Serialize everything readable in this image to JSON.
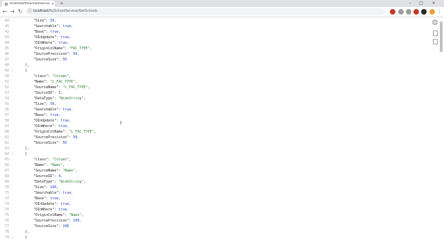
{
  "browser": {
    "tab_title": "localhost/fis/SchoolService/Get",
    "tab_close": "×",
    "new_tab": "+",
    "url_host": "localhost",
    "url_path": "/fis/SchoolService/GetSchools",
    "window_controls": [
      "–",
      "□",
      "×"
    ],
    "extension_colors": [
      "#c0392b",
      "#9e9e9e",
      "#9e9e9e",
      "#c0392b",
      "#2a2a2a",
      "#e8a33d"
    ]
  },
  "code_lines": [
    {
      "n": "40",
      "fold": "",
      "indent": "        ",
      "parts": [
        {
          "t": "\"Size\"",
          "c": "k"
        },
        {
          "t": ": ",
          "c": "p"
        },
        {
          "t": "50",
          "c": "n"
        },
        {
          "t": ",",
          "c": "p"
        }
      ]
    },
    {
      "n": "41",
      "fold": "",
      "indent": "        ",
      "parts": [
        {
          "t": "\"Searchable\"",
          "c": "k"
        },
        {
          "t": ": ",
          "c": "p"
        },
        {
          "t": "true",
          "c": "n"
        },
        {
          "t": ",",
          "c": "p"
        }
      ]
    },
    {
      "n": "42",
      "fold": "",
      "indent": "        ",
      "parts": [
        {
          "t": "\"Base\"",
          "c": "k"
        },
        {
          "t": ": ",
          "c": "p"
        },
        {
          "t": "true",
          "c": "n"
        },
        {
          "t": ",",
          "c": "p"
        }
      ]
    },
    {
      "n": "43",
      "fold": "",
      "indent": "        ",
      "parts": [
        {
          "t": "\"OInUpdate\"",
          "c": "k"
        },
        {
          "t": ": ",
          "c": "p"
        },
        {
          "t": "true",
          "c": "n"
        },
        {
          "t": ",",
          "c": "p"
        }
      ]
    },
    {
      "n": "44",
      "fold": "",
      "indent": "        ",
      "parts": [
        {
          "t": "\"OInWhere\"",
          "c": "k"
        },
        {
          "t": ": ",
          "c": "p"
        },
        {
          "t": "true",
          "c": "n"
        },
        {
          "t": ",",
          "c": "p"
        }
      ]
    },
    {
      "n": "45",
      "fold": "",
      "indent": "        ",
      "parts": [
        {
          "t": "\"OriginColName\"",
          "c": "k"
        },
        {
          "t": ": ",
          "c": "p"
        },
        {
          "t": "\"FAC_TYPE\"",
          "c": "s"
        },
        {
          "t": ",",
          "c": "p"
        }
      ]
    },
    {
      "n": "46",
      "fold": "",
      "indent": "        ",
      "parts": [
        {
          "t": "\"SourcePrecision\"",
          "c": "k"
        },
        {
          "t": ": ",
          "c": "p"
        },
        {
          "t": "50",
          "c": "n"
        },
        {
          "t": ",",
          "c": "p"
        }
      ]
    },
    {
      "n": "47",
      "fold": "",
      "indent": "        ",
      "parts": [
        {
          "t": "\"SourceSize\"",
          "c": "k"
        },
        {
          "t": ": ",
          "c": "p"
        },
        {
          "t": "50",
          "c": "n"
        }
      ]
    },
    {
      "n": "48",
      "fold": "",
      "indent": "    ",
      "parts": [
        {
          "t": "},",
          "c": "p"
        }
      ]
    },
    {
      "n": "49",
      "fold": "▾",
      "indent": "    ",
      "parts": [
        {
          "t": "{",
          "c": "p"
        }
      ]
    },
    {
      "n": "50",
      "fold": "",
      "indent": "        ",
      "parts": [
        {
          "t": "\"class\"",
          "c": "k"
        },
        {
          "t": ": ",
          "c": "p"
        },
        {
          "t": "\"Column\"",
          "c": "s"
        },
        {
          "t": ",",
          "c": "p"
        }
      ]
    },
    {
      "n": "51",
      "fold": "",
      "indent": "        ",
      "parts": [
        {
          "t": "\"Name\"",
          "c": "k"
        },
        {
          "t": ": ",
          "c": "p"
        },
        {
          "t": "\"L_FAC_TYPE\"",
          "c": "s"
        },
        {
          "t": ",",
          "c": "p"
        }
      ]
    },
    {
      "n": "52",
      "fold": "",
      "indent": "        ",
      "parts": [
        {
          "t": "\"SourceName\"",
          "c": "k"
        },
        {
          "t": ": ",
          "c": "p"
        },
        {
          "t": "\"L_FAC_TYPE\"",
          "c": "s"
        },
        {
          "t": ",",
          "c": "p"
        }
      ]
    },
    {
      "n": "53",
      "fold": "",
      "indent": "        ",
      "parts": [
        {
          "t": "\"SourceID\"",
          "c": "k"
        },
        {
          "t": ": ",
          "c": "p"
        },
        {
          "t": "3",
          "c": "n"
        },
        {
          "t": ",",
          "c": "p"
        }
      ]
    },
    {
      "n": "54",
      "fold": "",
      "indent": "        ",
      "parts": [
        {
          "t": "\"DataType\"",
          "c": "k"
        },
        {
          "t": ": ",
          "c": "p"
        },
        {
          "t": "\"WideString\"",
          "c": "s"
        },
        {
          "t": ",",
          "c": "p"
        }
      ]
    },
    {
      "n": "55",
      "fold": "",
      "indent": "        ",
      "parts": [
        {
          "t": "\"Size\"",
          "c": "k"
        },
        {
          "t": ": ",
          "c": "p"
        },
        {
          "t": "50",
          "c": "n"
        },
        {
          "t": ",",
          "c": "p"
        }
      ]
    },
    {
      "n": "56",
      "fold": "",
      "indent": "        ",
      "parts": [
        {
          "t": "\"Searchable\"",
          "c": "k"
        },
        {
          "t": ": ",
          "c": "p"
        },
        {
          "t": "true",
          "c": "n"
        },
        {
          "t": ",",
          "c": "p"
        }
      ]
    },
    {
      "n": "57",
      "fold": "",
      "indent": "        ",
      "parts": [
        {
          "t": "\"Base\"",
          "c": "k"
        },
        {
          "t": ": ",
          "c": "p"
        },
        {
          "t": "true",
          "c": "n"
        },
        {
          "t": ",",
          "c": "p"
        }
      ]
    },
    {
      "n": "58",
      "fold": "",
      "indent": "        ",
      "parts": [
        {
          "t": "\"OInUpdate\"",
          "c": "k"
        },
        {
          "t": ": ",
          "c": "p"
        },
        {
          "t": "true",
          "c": "n"
        },
        {
          "t": ",",
          "c": "p"
        }
      ]
    },
    {
      "n": "59",
      "fold": "",
      "indent": "        ",
      "parts": [
        {
          "t": "\"OInWhere\"",
          "c": "k"
        },
        {
          "t": ": ",
          "c": "p"
        },
        {
          "t": "true",
          "c": "n"
        },
        {
          "t": ",",
          "c": "p"
        }
      ]
    },
    {
      "n": "60",
      "fold": "",
      "indent": "        ",
      "parts": [
        {
          "t": "\"OriginColName\"",
          "c": "k"
        },
        {
          "t": ": ",
          "c": "p"
        },
        {
          "t": "\"L_FAC_TYPE\"",
          "c": "s"
        },
        {
          "t": ",",
          "c": "p"
        }
      ]
    },
    {
      "n": "61",
      "fold": "",
      "indent": "        ",
      "parts": [
        {
          "t": "\"SourcePrecision\"",
          "c": "k"
        },
        {
          "t": ": ",
          "c": "p"
        },
        {
          "t": "50",
          "c": "n"
        },
        {
          "t": ",",
          "c": "p"
        }
      ]
    },
    {
      "n": "62",
      "fold": "",
      "indent": "        ",
      "parts": [
        {
          "t": "\"SourceSize\"",
          "c": "k"
        },
        {
          "t": ": ",
          "c": "p"
        },
        {
          "t": "50",
          "c": "n"
        }
      ]
    },
    {
      "n": "63",
      "fold": "",
      "indent": "    ",
      "parts": [
        {
          "t": "},",
          "c": "p"
        }
      ]
    },
    {
      "n": "64",
      "fold": "▾",
      "indent": "    ",
      "parts": [
        {
          "t": "{",
          "c": "p"
        }
      ]
    },
    {
      "n": "65",
      "fold": "",
      "indent": "        ",
      "parts": [
        {
          "t": "\"class\"",
          "c": "k"
        },
        {
          "t": ": ",
          "c": "p"
        },
        {
          "t": "\"Column\"",
          "c": "s"
        },
        {
          "t": ",",
          "c": "p"
        }
      ]
    },
    {
      "n": "66",
      "fold": "",
      "indent": "        ",
      "parts": [
        {
          "t": "\"Name\"",
          "c": "k"
        },
        {
          "t": ": ",
          "c": "p"
        },
        {
          "t": "\"Name\"",
          "c": "s"
        },
        {
          "t": ",",
          "c": "p"
        }
      ]
    },
    {
      "n": "67",
      "fold": "",
      "indent": "        ",
      "parts": [
        {
          "t": "\"SourceName\"",
          "c": "k"
        },
        {
          "t": ": ",
          "c": "p"
        },
        {
          "t": "\"Name\"",
          "c": "s"
        },
        {
          "t": ",",
          "c": "p"
        }
      ]
    },
    {
      "n": "68",
      "fold": "",
      "indent": "        ",
      "parts": [
        {
          "t": "\"SourceID\"",
          "c": "k"
        },
        {
          "t": ": ",
          "c": "p"
        },
        {
          "t": "4",
          "c": "n"
        },
        {
          "t": ",",
          "c": "p"
        }
      ]
    },
    {
      "n": "69",
      "fold": "",
      "indent": "        ",
      "parts": [
        {
          "t": "\"DataType\"",
          "c": "k"
        },
        {
          "t": ": ",
          "c": "p"
        },
        {
          "t": "\"WideString\"",
          "c": "s"
        },
        {
          "t": ",",
          "c": "p"
        }
      ]
    },
    {
      "n": "70",
      "fold": "",
      "indent": "        ",
      "parts": [
        {
          "t": "\"Size\"",
          "c": "k"
        },
        {
          "t": ": ",
          "c": "p"
        },
        {
          "t": "100",
          "c": "n"
        },
        {
          "t": ",",
          "c": "p"
        }
      ]
    },
    {
      "n": "71",
      "fold": "",
      "indent": "        ",
      "parts": [
        {
          "t": "\"Searchable\"",
          "c": "k"
        },
        {
          "t": ": ",
          "c": "p"
        },
        {
          "t": "true",
          "c": "n"
        },
        {
          "t": ",",
          "c": "p"
        }
      ]
    },
    {
      "n": "72",
      "fold": "",
      "indent": "        ",
      "parts": [
        {
          "t": "\"Base\"",
          "c": "k"
        },
        {
          "t": ": ",
          "c": "p"
        },
        {
          "t": "true",
          "c": "n"
        },
        {
          "t": ",",
          "c": "p"
        }
      ]
    },
    {
      "n": "73",
      "fold": "",
      "indent": "        ",
      "parts": [
        {
          "t": "\"OInUpdate\"",
          "c": "k"
        },
        {
          "t": ": ",
          "c": "p"
        },
        {
          "t": "true",
          "c": "n"
        },
        {
          "t": ",",
          "c": "p"
        }
      ]
    },
    {
      "n": "74",
      "fold": "",
      "indent": "        ",
      "parts": [
        {
          "t": "\"OInWhere\"",
          "c": "k"
        },
        {
          "t": ": ",
          "c": "p"
        },
        {
          "t": "true",
          "c": "n"
        },
        {
          "t": ",",
          "c": "p"
        }
      ]
    },
    {
      "n": "75",
      "fold": "",
      "indent": "        ",
      "parts": [
        {
          "t": "\"OriginColName\"",
          "c": "k"
        },
        {
          "t": ": ",
          "c": "p"
        },
        {
          "t": "\"Name\"",
          "c": "s"
        },
        {
          "t": ",",
          "c": "p"
        }
      ]
    },
    {
      "n": "76",
      "fold": "",
      "indent": "        ",
      "parts": [
        {
          "t": "\"SourcePrecision\"",
          "c": "k"
        },
        {
          "t": ": ",
          "c": "p"
        },
        {
          "t": "100",
          "c": "n"
        },
        {
          "t": ",",
          "c": "p"
        }
      ]
    },
    {
      "n": "77",
      "fold": "",
      "indent": "        ",
      "parts": [
        {
          "t": "\"SourceSize\"",
          "c": "k"
        },
        {
          "t": ": ",
          "c": "p"
        },
        {
          "t": "100",
          "c": "n"
        }
      ]
    },
    {
      "n": "78",
      "fold": "",
      "indent": "    ",
      "parts": [
        {
          "t": "},",
          "c": "p"
        }
      ]
    },
    {
      "n": "79",
      "fold": "▾",
      "indent": "    ",
      "parts": [
        {
          "t": "{",
          "c": "p"
        }
      ]
    }
  ]
}
